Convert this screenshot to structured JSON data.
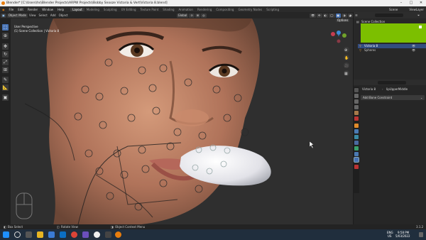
{
  "window": {
    "title": "Blender* [C:\\Users\\hs\\Blender Projects\\ARPW Projects\\Bobby Snooze Victoria & Vert\\Victoria 8.blend]",
    "controls": [
      "–",
      "□",
      "✕"
    ]
  },
  "menu": {
    "items": [
      "File",
      "Edit",
      "Render",
      "Window",
      "Help"
    ],
    "workspaces": [
      "Layout",
      "Modeling",
      "Sculpting",
      "UV Editing",
      "Texture Paint",
      "Shading",
      "Animation",
      "Rendering",
      "Compositing",
      "Geometry Nodes",
      "Scripting"
    ],
    "active_workspace": "Layout",
    "scene_label": "Scene",
    "view_layer_label": "ViewLayer"
  },
  "viewport_header": {
    "mode": "Object Mode",
    "menus": [
      "View",
      "Select",
      "Add",
      "Object"
    ],
    "orientation": "Global",
    "options_label": "Options"
  },
  "viewport": {
    "perspective_label": "User Perspective",
    "collection_label": "(1) Scene Collection | Victoria 8"
  },
  "outliner": {
    "root": "Scene Collection",
    "items": [
      "Victoria 8",
      "Spheres"
    ]
  },
  "properties": {
    "object_name": "Victoria 8",
    "modifier_name": "lipUpperMiddle",
    "add_constraint_label": "Add Bone Constraint"
  },
  "statusbar": {
    "left": "Select",
    "box_select": "Box Select",
    "rotate": "Rotate View",
    "context": "Object Context Menu",
    "version": "3.1.2"
  },
  "taskbar": {
    "lang1": "ENG",
    "lang2": "US",
    "time": "9:58 PM",
    "date": "5/03/2022"
  },
  "colors": {
    "accent": "#4772b3",
    "selected_green": "#7cbf00",
    "blender_orange": "#e87d0d"
  }
}
